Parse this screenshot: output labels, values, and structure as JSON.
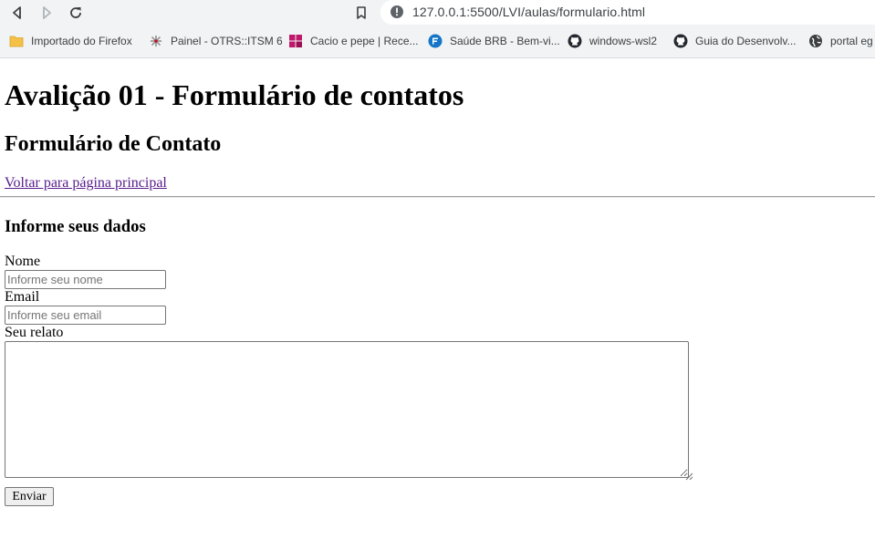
{
  "browser": {
    "url": "127.0.0.1:5500/LVI/aulas/formulario.html",
    "bookmarks": [
      {
        "label": "Importado do Firefox",
        "icon": "folder-icon"
      },
      {
        "label": "Painel - OTRS::ITSM 6",
        "icon": "otrs-icon"
      },
      {
        "label": "Cacio e pepe | Rece...",
        "icon": "recipe-icon"
      },
      {
        "label": "Saúde BRB - Bem-vi...",
        "icon": "saude-icon"
      },
      {
        "label": "windows-wsl2",
        "icon": "github-icon"
      },
      {
        "label": "Guia do Desenvolv...",
        "icon": "github-icon"
      },
      {
        "label": "portal eg",
        "icon": "globe-icon"
      }
    ]
  },
  "page": {
    "title": "Avalição 01 - Formulário de contatos",
    "subtitle": "Formulário de Contato",
    "back_link": "Voltar para página principal",
    "section_title": "Informe seus dados"
  },
  "form": {
    "name_label": "Nome",
    "name_placeholder": "Informe seu nome",
    "email_label": "Email",
    "email_placeholder": "Informe seu email",
    "relato_label": "Seu relato",
    "submit_label": "Enviar"
  },
  "colors": {
    "visited_link": "#551a8b",
    "chrome_bg": "#f1f3f4"
  }
}
